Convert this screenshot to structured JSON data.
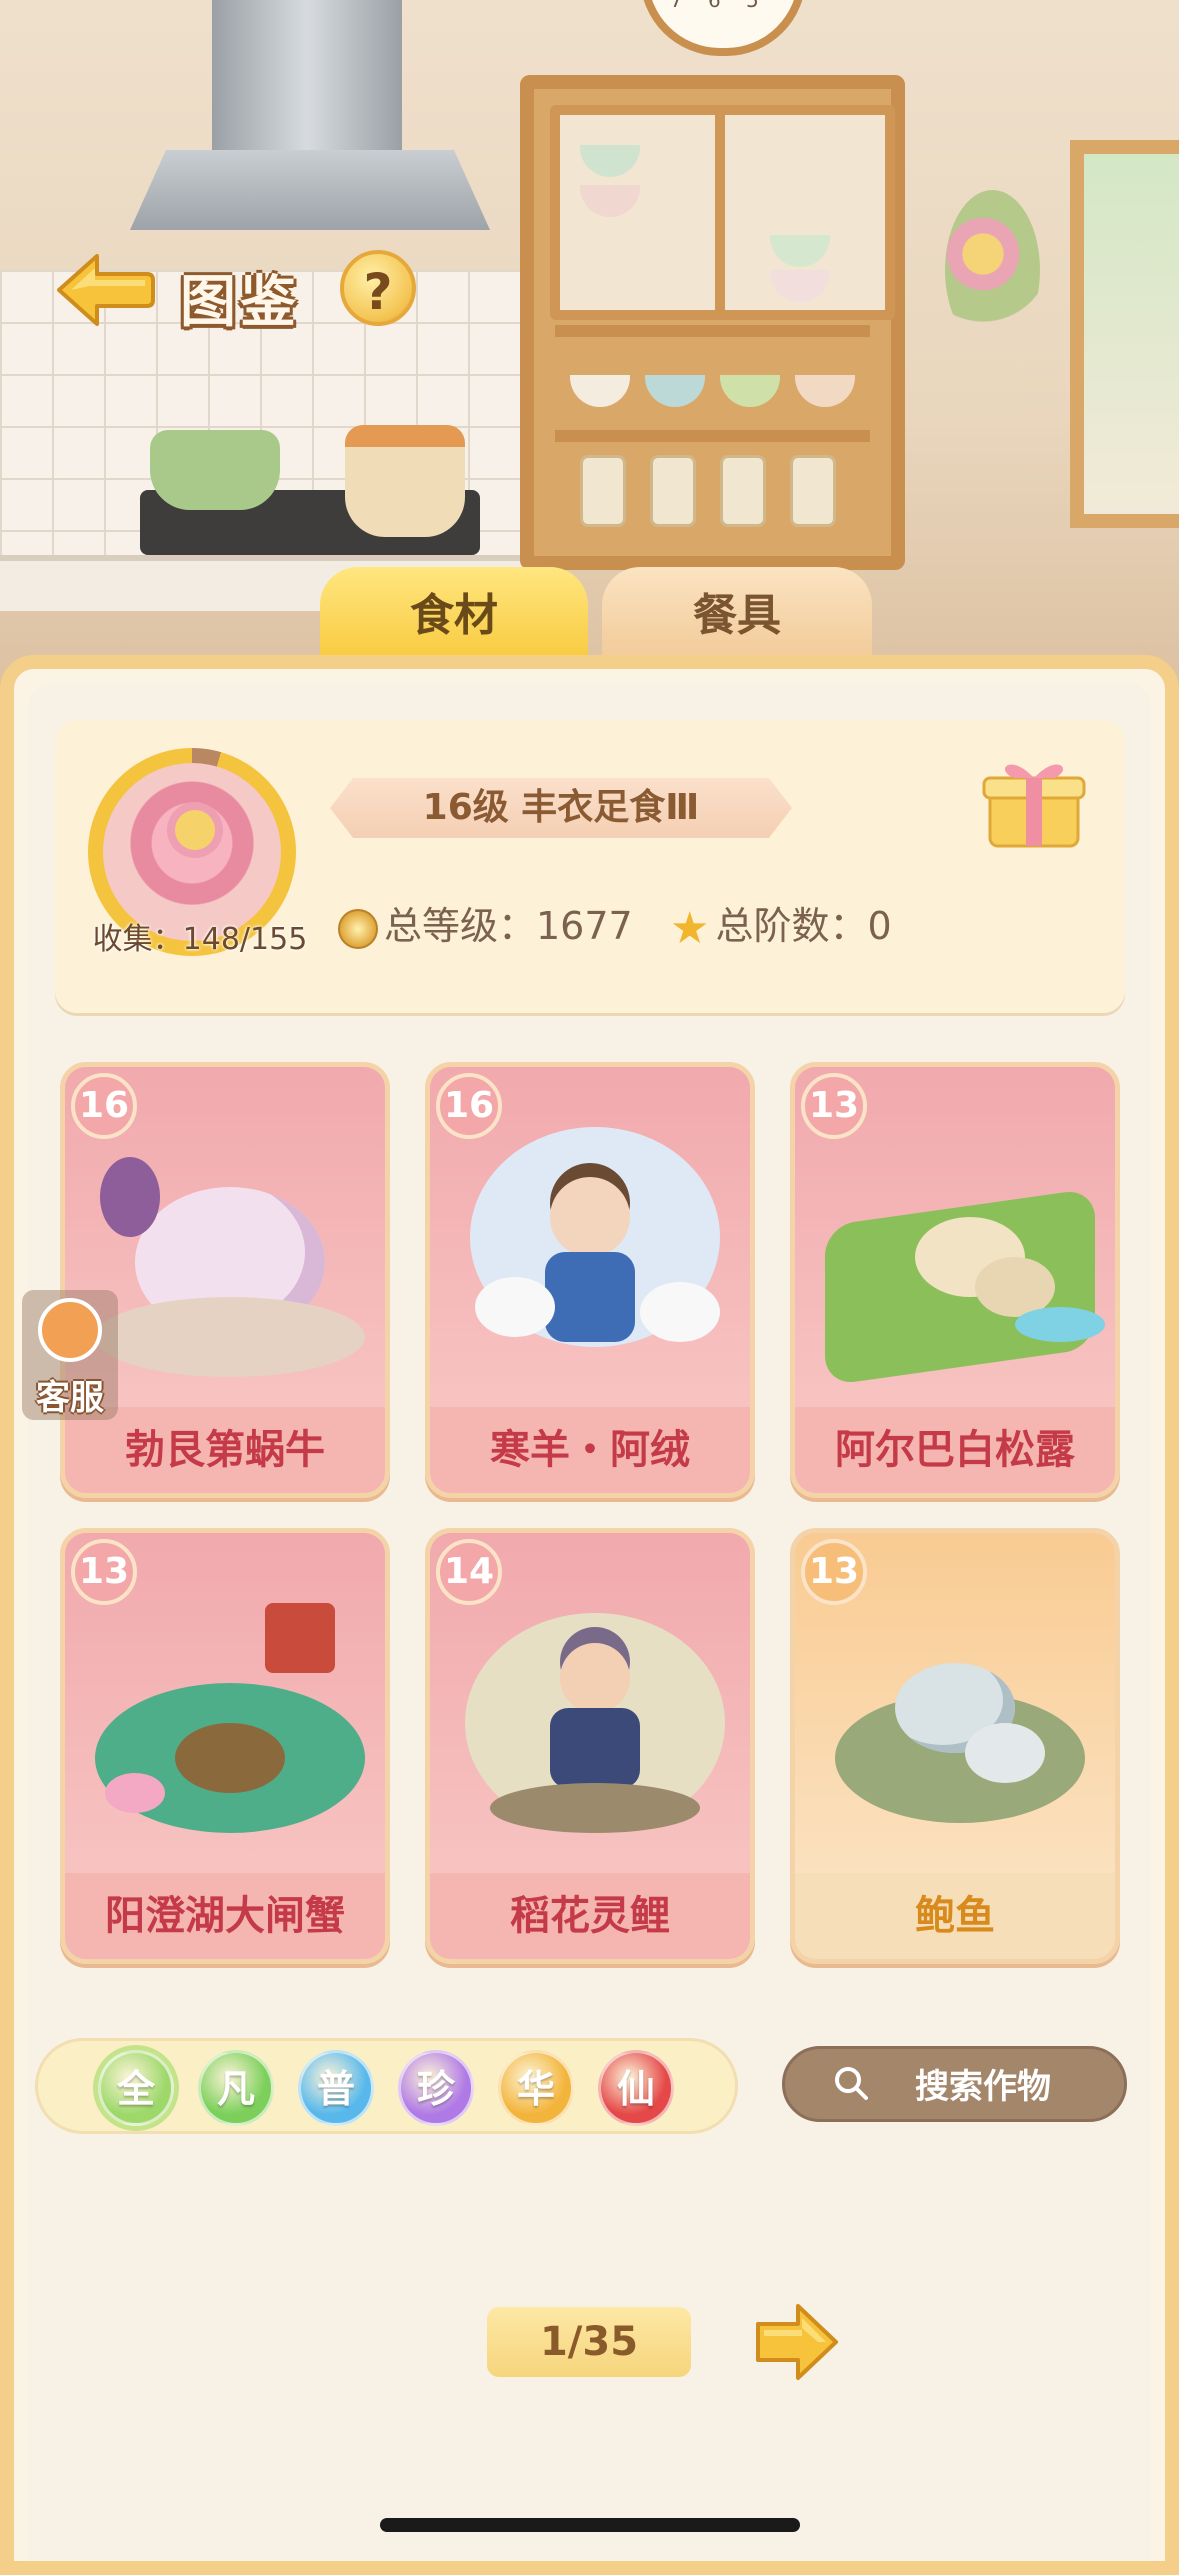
{
  "header": {
    "title": "图鉴"
  },
  "tabs": [
    {
      "label": "食材",
      "active": true
    },
    {
      "label": "餐具",
      "active": false
    }
  ],
  "profile": {
    "collect": "收集：148/155",
    "collect_progress": 0.955,
    "level_title": "16级  丰衣足食Ⅲ",
    "total_level": "总等级：1677",
    "total_rank": "总阶数：0"
  },
  "service": {
    "label": "客服"
  },
  "cards": [
    {
      "level": "16",
      "name": "勃艮第蜗牛",
      "rarity": "pink"
    },
    {
      "level": "16",
      "name": "寒羊・阿绒",
      "rarity": "pink"
    },
    {
      "level": "13",
      "name": "阿尔巴白松露",
      "rarity": "pink"
    },
    {
      "level": "13",
      "name": "阳澄湖大闸蟹",
      "rarity": "pink"
    },
    {
      "level": "14",
      "name": "稻花灵鲤",
      "rarity": "pink"
    },
    {
      "level": "13",
      "name": "鲍鱼",
      "rarity": "gold"
    }
  ],
  "filters": [
    {
      "label": "全",
      "color": "#9ed86b",
      "selected": true
    },
    {
      "label": "凡",
      "color": "#7bcf5a",
      "selected": false
    },
    {
      "label": "普",
      "color": "#58b8ec",
      "selected": false
    },
    {
      "label": "珍",
      "color": "#b07ae6",
      "selected": false
    },
    {
      "label": "华",
      "color": "#f3b43c",
      "selected": false
    },
    {
      "label": "仙",
      "color": "#e44848",
      "selected": false
    }
  ],
  "search": {
    "label": "搜索作物"
  },
  "pagination": {
    "indicator": "1/35"
  },
  "scene": {
    "clock_numbers": [
      "7",
      "6",
      "5"
    ]
  }
}
